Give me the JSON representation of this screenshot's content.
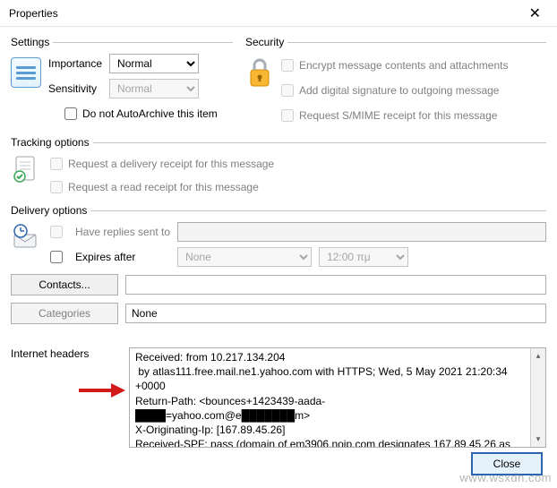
{
  "titlebar": {
    "title": "Properties"
  },
  "settings": {
    "legend": "Settings",
    "importance_label": "Importance",
    "importance_value": "Normal",
    "sensitivity_label": "Sensitivity",
    "sensitivity_value": "Normal",
    "autoarchive_label": "Do not AutoArchive this item"
  },
  "security": {
    "legend": "Security",
    "encrypt_label": "Encrypt message contents and attachments",
    "sign_label": "Add digital signature to outgoing message",
    "smime_label": "Request S/MIME receipt for this message"
  },
  "tracking": {
    "legend": "Tracking options",
    "delivery_receipt_label": "Request a delivery receipt for this message",
    "read_receipt_label": "Request a read receipt for this message"
  },
  "delivery": {
    "legend": "Delivery options",
    "have_replies_label": "Have replies sent to",
    "have_replies_value": "",
    "expires_label": "Expires after",
    "expires_date": "None",
    "expires_time": "12:00 πμ"
  },
  "lower": {
    "contacts_btn": "Contacts...",
    "contacts_value": "",
    "categories_btn": "Categories",
    "categories_value": "None"
  },
  "headers": {
    "label": "Internet headers",
    "text": "Received: from 10.217.134.204\n by atlas111.free.mail.ne1.yahoo.com with HTTPS; Wed, 5 May 2021 21:20:34 +0000\nReturn-Path: <bounces+1423439-aada-\n████=yahoo.com@e███████m>\nX-Originating-Ip: [167.89.45.26]\nReceived-SPF: pass (domain of em3906.noip.com designates 167.89.45.26 as"
  },
  "footer": {
    "close_btn": "Close"
  },
  "watermark": "www.wsxdn.com"
}
